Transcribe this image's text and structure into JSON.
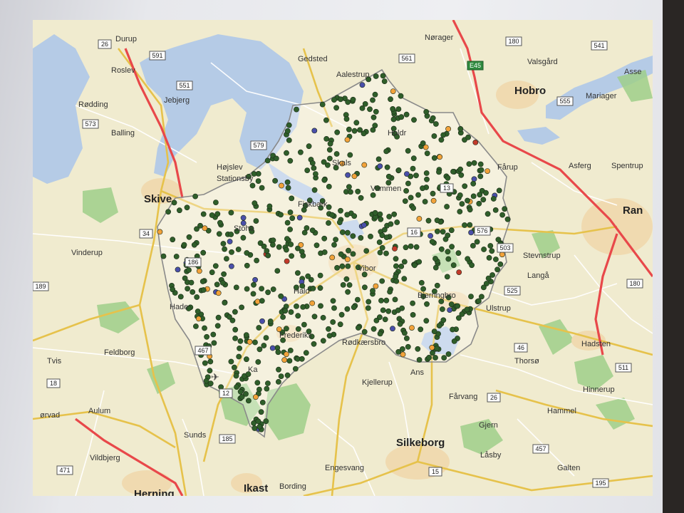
{
  "map": {
    "colors": {
      "land": "#f0ebcf",
      "water": "#b5cbe6",
      "forest": "#9fcf8a",
      "urban": "#f0dab0",
      "motorway": "#e8484a",
      "main_road": "#e6c24b",
      "minor_road": "#ffffff",
      "boundary": "#8a8a8a",
      "dot_green": "#2f5e2a",
      "dot_blue": "#4a4faa",
      "dot_orange": "#f2a23a",
      "dot_red": "#c23a2a"
    },
    "place_labels": [
      {
        "id": "durup",
        "text": "Durup"
      },
      {
        "id": "roslev",
        "text": "Roslev"
      },
      {
        "id": "jebjerg",
        "text": "Jebjerg"
      },
      {
        "id": "rodding",
        "text": "Rødding"
      },
      {
        "id": "balling",
        "text": "Balling"
      },
      {
        "id": "gedsted",
        "text": "Gedsted"
      },
      {
        "id": "aalestrup",
        "text": "Aalestrup"
      },
      {
        "id": "noerager",
        "text": "Nørager"
      },
      {
        "id": "valsgard",
        "text": "Valsgård"
      },
      {
        "id": "hobro",
        "text": "Hobro"
      },
      {
        "id": "mariager",
        "text": "Mariager"
      },
      {
        "id": "asse",
        "text": "Asse"
      },
      {
        "id": "hojslev",
        "text": "Højslev"
      },
      {
        "id": "stationsby",
        "text": "Stationsby"
      },
      {
        "id": "skive",
        "text": "Skive"
      },
      {
        "id": "skals",
        "text": "Skals"
      },
      {
        "id": "vammen",
        "text": "Vammen"
      },
      {
        "id": "farup",
        "text": "Fårup"
      },
      {
        "id": "asferg",
        "text": "Asferg"
      },
      {
        "id": "spentrup",
        "text": "Spentrup"
      },
      {
        "id": "ran",
        "text": "Ran"
      },
      {
        "id": "vinderup",
        "text": "Vinderup"
      },
      {
        "id": "stevnstrup",
        "text": "Stevnstrup"
      },
      {
        "id": "langa",
        "text": "Langå"
      },
      {
        "id": "bjerringbro",
        "text": "Bjerringbro"
      },
      {
        "id": "ulstrup",
        "text": "Ulstrup"
      },
      {
        "id": "frederiks",
        "text": "Frederiks"
      },
      {
        "id": "rodkaersbro",
        "text": "Rødkærsbro"
      },
      {
        "id": "hadsten",
        "text": "Hadsten"
      },
      {
        "id": "feldborg",
        "text": "Feldborg"
      },
      {
        "id": "tvis",
        "text": "Tvis"
      },
      {
        "id": "thorso",
        "text": "Thorsø"
      },
      {
        "id": "ans",
        "text": "Ans"
      },
      {
        "id": "kjellerup",
        "text": "Kjellerup"
      },
      {
        "id": "farvang",
        "text": "Fårvang"
      },
      {
        "id": "hinnerup",
        "text": "Hinnerup"
      },
      {
        "id": "hammel",
        "text": "Hammel"
      },
      {
        "id": "orvad",
        "text": "ørvad"
      },
      {
        "id": "aulum",
        "text": "Aulum"
      },
      {
        "id": "sunds",
        "text": "Sunds"
      },
      {
        "id": "gjern",
        "text": "Gjern"
      },
      {
        "id": "silkeborg",
        "text": "Silkeborg"
      },
      {
        "id": "vildbjerg",
        "text": "Vildbjerg"
      },
      {
        "id": "engesvang",
        "text": "Engesvang"
      },
      {
        "id": "galten",
        "text": "Galten"
      },
      {
        "id": "labsby",
        "text": "Låsby"
      },
      {
        "id": "herning",
        "text": "Herning"
      },
      {
        "id": "ikast",
        "text": "Ikast"
      },
      {
        "id": "bording",
        "text": "Bording"
      },
      {
        "id": "holdr",
        "text": "Holdr"
      },
      {
        "id": "fiskbaek",
        "text": "Fiskbæk"
      },
      {
        "id": "stoholm",
        "text": "Stoho"
      },
      {
        "id": "viborg",
        "text": "Vibor"
      },
      {
        "id": "hald",
        "text": "Hald"
      },
      {
        "id": "haderup",
        "text": "Hade"
      },
      {
        "id": "karup",
        "text": "Ka"
      }
    ],
    "road_shields": [
      {
        "id": "r26a",
        "text": "26"
      },
      {
        "id": "r591",
        "text": "591"
      },
      {
        "id": "r551",
        "text": "551"
      },
      {
        "id": "r573",
        "text": "573"
      },
      {
        "id": "r561",
        "text": "561"
      },
      {
        "id": "r180a",
        "text": "180"
      },
      {
        "id": "e45",
        "text": "E45"
      },
      {
        "id": "r541",
        "text": "541"
      },
      {
        "id": "r555",
        "text": "555"
      },
      {
        "id": "r579",
        "text": "579"
      },
      {
        "id": "r34",
        "text": "34"
      },
      {
        "id": "r186",
        "text": "186"
      },
      {
        "id": "r189",
        "text": "189"
      },
      {
        "id": "r16",
        "text": "16"
      },
      {
        "id": "r13",
        "text": "13"
      },
      {
        "id": "r576",
        "text": "576"
      },
      {
        "id": "r503",
        "text": "503"
      },
      {
        "id": "r525",
        "text": "525"
      },
      {
        "id": "r180b",
        "text": "180"
      },
      {
        "id": "r467",
        "text": "467"
      },
      {
        "id": "r46",
        "text": "46"
      },
      {
        "id": "r511",
        "text": "511"
      },
      {
        "id": "r18",
        "text": "18"
      },
      {
        "id": "r12",
        "text": "12"
      },
      {
        "id": "r26b",
        "text": "26"
      },
      {
        "id": "r185",
        "text": "185"
      },
      {
        "id": "r457",
        "text": "457"
      },
      {
        "id": "r471",
        "text": "471"
      },
      {
        "id": "r15",
        "text": "15"
      },
      {
        "id": "r195",
        "text": "195"
      }
    ]
  }
}
